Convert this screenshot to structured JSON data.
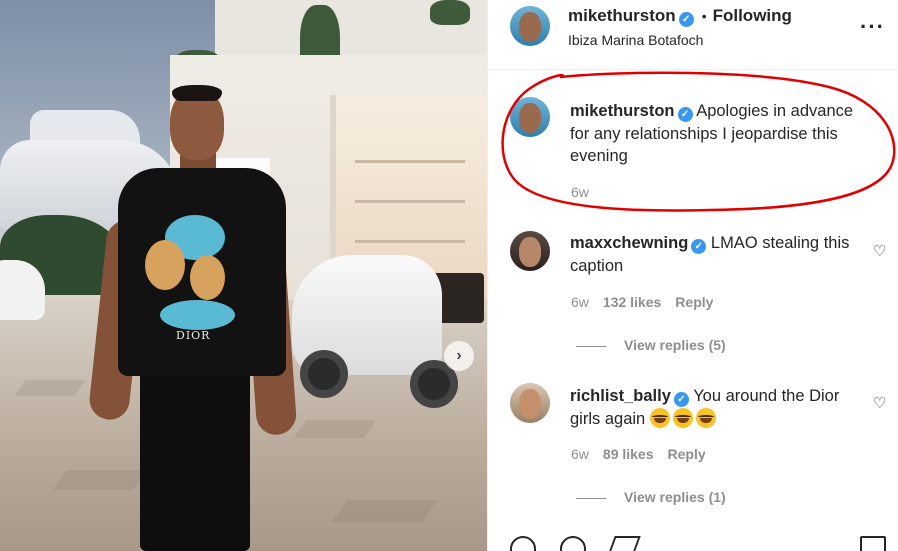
{
  "post": {
    "author": "mikethurston",
    "follow_status": "Following",
    "location": "Ibiza Marina Botafoch",
    "more_icon": "more-options-icon",
    "shirt_text": "DIOR"
  },
  "caption": {
    "username": "mikethurston",
    "text": "Apologies in advance for any relationships I jeopardise this evening",
    "time": "6w"
  },
  "comments": [
    {
      "username": "maxxchewning",
      "text": "LMAO stealing this caption",
      "time": "6w",
      "likes": "132 likes",
      "reply_label": "Reply",
      "view_replies": "View replies (5)"
    },
    {
      "username": "richlist_bally",
      "text": "You around the Dior girls again ",
      "emoji": "😂😂😂",
      "time": "6w",
      "likes": "89 likes",
      "reply_label": "Reply",
      "view_replies": "View replies (1)"
    }
  ],
  "colors": {
    "verified": "#3897f0",
    "annotation": "#e00000",
    "muted": "#8e8e8e",
    "text": "#262626"
  }
}
